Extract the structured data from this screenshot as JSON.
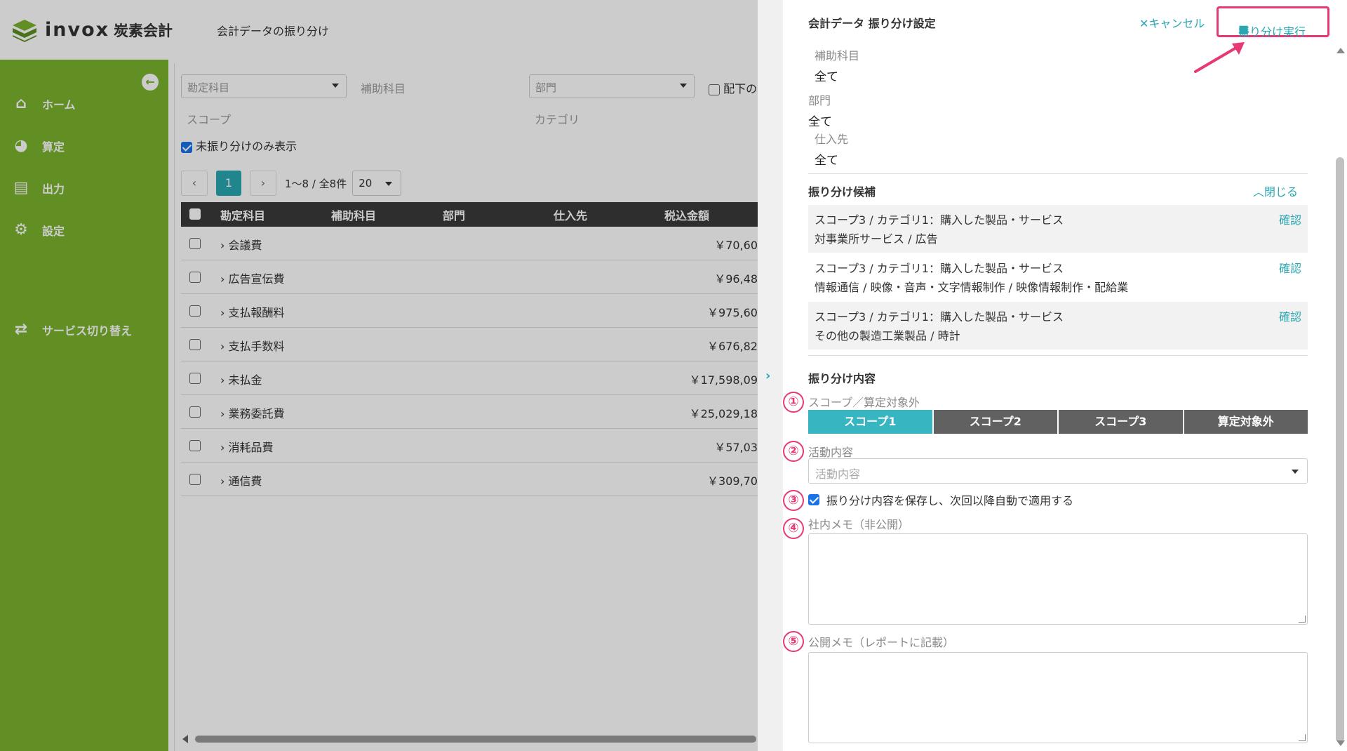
{
  "app": {
    "brand": "invox",
    "brand_sub": "炭素会計",
    "page_title": "会計データの振り分け"
  },
  "sidebar": {
    "items": [
      {
        "label": "ホーム",
        "icon": "home-icon"
      },
      {
        "label": "算定",
        "icon": "pie-chart-icon"
      },
      {
        "label": "出力",
        "icon": "export-icon"
      },
      {
        "label": "設定",
        "icon": "gear-icon"
      },
      {
        "label": "サービス切り替え",
        "icon": "switch-icon"
      }
    ]
  },
  "filters": {
    "account_placeholder": "勘定科目",
    "sub_account_label": "補助科目",
    "department_placeholder": "部門",
    "include_children_label": "配下の",
    "scope_label": "スコープ",
    "category_label": "カテゴリ",
    "unassigned_only_label": "未振り分けのみ表示",
    "unassigned_only_checked": true
  },
  "pager": {
    "prev": "‹",
    "current": "1",
    "next": "›",
    "info": "1〜8 / 全8件",
    "page_size": "20"
  },
  "table": {
    "headers": [
      "勘定科目",
      "補助科目",
      "部門",
      "仕入先",
      "税込金額"
    ],
    "rows": [
      {
        "name": "会議費",
        "amount": "￥70,60"
      },
      {
        "name": "広告宣伝費",
        "amount": "￥96,48"
      },
      {
        "name": "支払報酬料",
        "amount": "￥975,60"
      },
      {
        "name": "支払手数料",
        "amount": "￥676,82"
      },
      {
        "name": "未払金",
        "amount": "￥17,598,09"
      },
      {
        "name": "業務委託費",
        "amount": "￥25,029,18"
      },
      {
        "name": "消耗品費",
        "amount": "￥57,03"
      },
      {
        "name": "通信費",
        "amount": "￥309,70"
      }
    ]
  },
  "panel": {
    "title": "会計データ 振り分け設定",
    "cancel_label": "キャンセル",
    "execute_label": "振り分け実行",
    "fields": {
      "sub_account_label": "補助科目",
      "sub_account_value": "全て",
      "department_label": "部門",
      "department_value": "全て",
      "vendor_label": "仕入先",
      "vendor_value": "全て"
    },
    "candidates_title": "振り分け候補",
    "close_label": "閉じる",
    "candidates": [
      {
        "line1": "スコープ3 / カテゴリ1：購入した製品・サービス",
        "line2": "対事業所サービス / 広告",
        "action": "確認"
      },
      {
        "line1": "スコープ3 / カテゴリ1：購入した製品・サービス",
        "line2": "情報通信 / 映像・音声・文字情報制作 / 映像情報制作・配給業",
        "action": "確認"
      },
      {
        "line1": "スコープ3 / カテゴリ1：購入した製品・サービス",
        "line2": "その他の製造工業製品 / 時計",
        "action": "確認"
      }
    ],
    "content_title": "振り分け内容",
    "scope_label": "スコープ／算定対象外",
    "scope_options": [
      "スコープ1",
      "スコープ2",
      "スコープ3",
      "算定対象外"
    ],
    "scope_selected": "スコープ1",
    "activity_label": "活動内容",
    "activity_placeholder": "活動内容",
    "save_label": "振り分け内容を保存し、次回以降自動で適用する",
    "save_checked": true,
    "internal_memo_label": "社内メモ（非公開）",
    "public_memo_label": "公開メモ（レポートに記載）",
    "badges": [
      "①",
      "②",
      "③",
      "④",
      "⑤"
    ]
  },
  "colors": {
    "sidebar_green": "#7bb32e",
    "accent_teal": "#2aa7b2",
    "highlight_pink": "#e83875",
    "header_dark": "#3a3a3a"
  }
}
